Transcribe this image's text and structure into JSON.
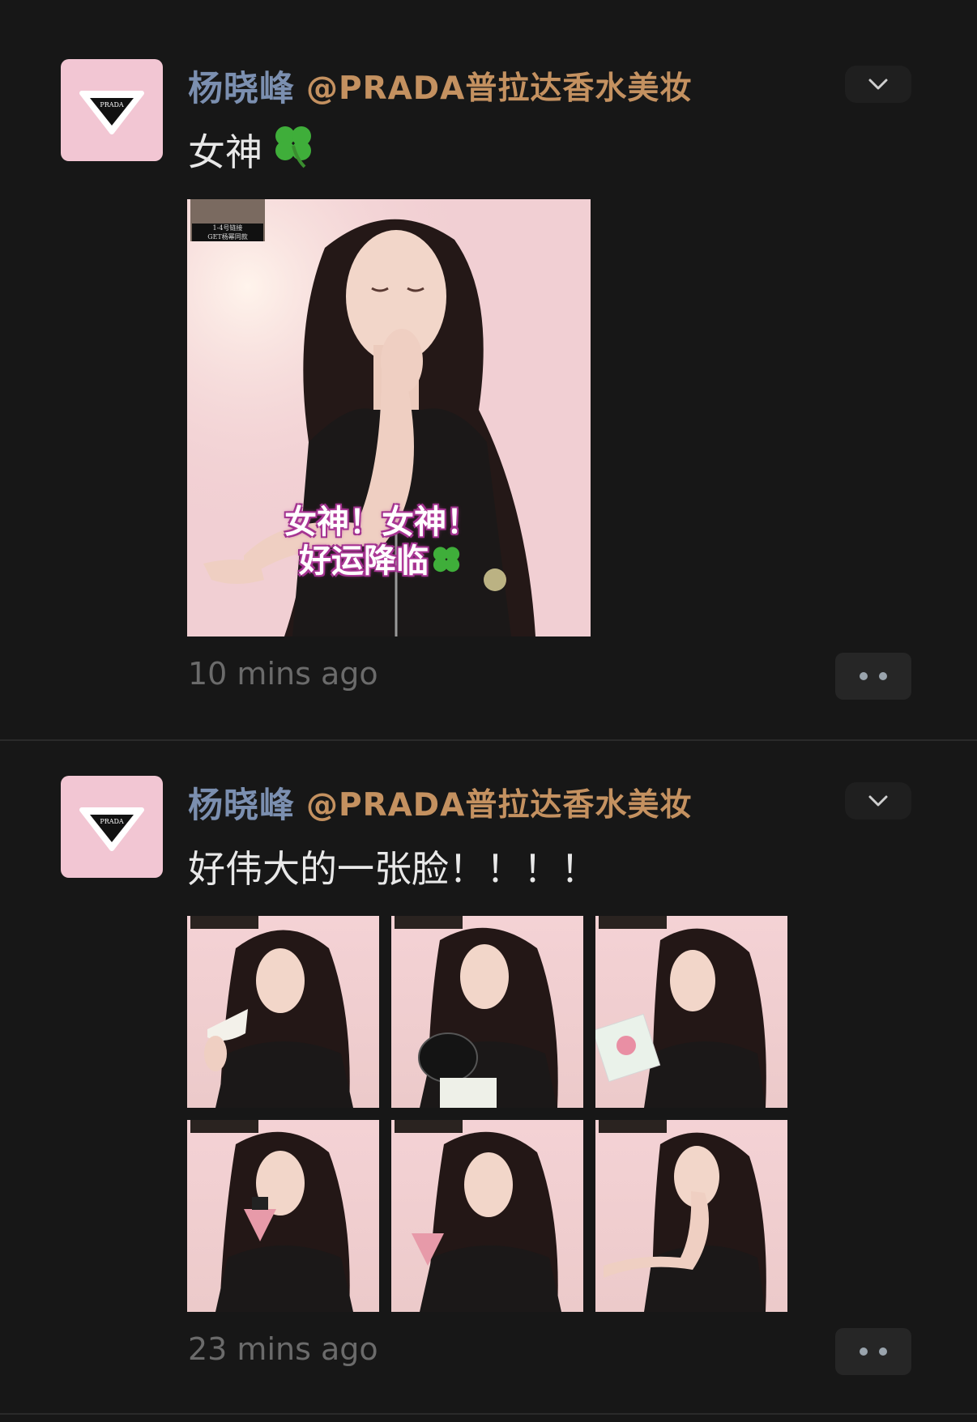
{
  "posts": [
    {
      "author": "杨晓峰",
      "mention": "@PRADA普拉达香水美妆",
      "text": "女神",
      "time": "10 mins ago",
      "image": {
        "badge_line1": "1-4号链接",
        "badge_line2": "GET杨幂同款",
        "overlay_line1": "女神！女神！",
        "overlay_line2": "好运降临"
      }
    },
    {
      "author": "杨晓峰",
      "mention": "@PRADA普拉达香水美妆",
      "text": "好伟大的一张脸！！！！",
      "time": "23 mins ago"
    }
  ],
  "avatar_logo_text": "PRADA",
  "colors": {
    "background": "#171717",
    "author": "#7b8fb0",
    "mention": "#c49160",
    "time": "#6b6b6b",
    "photo_bg": "#f4d2d5"
  },
  "icons": [
    "chevron-down-icon",
    "more-dots-icon",
    "clover-icon"
  ]
}
